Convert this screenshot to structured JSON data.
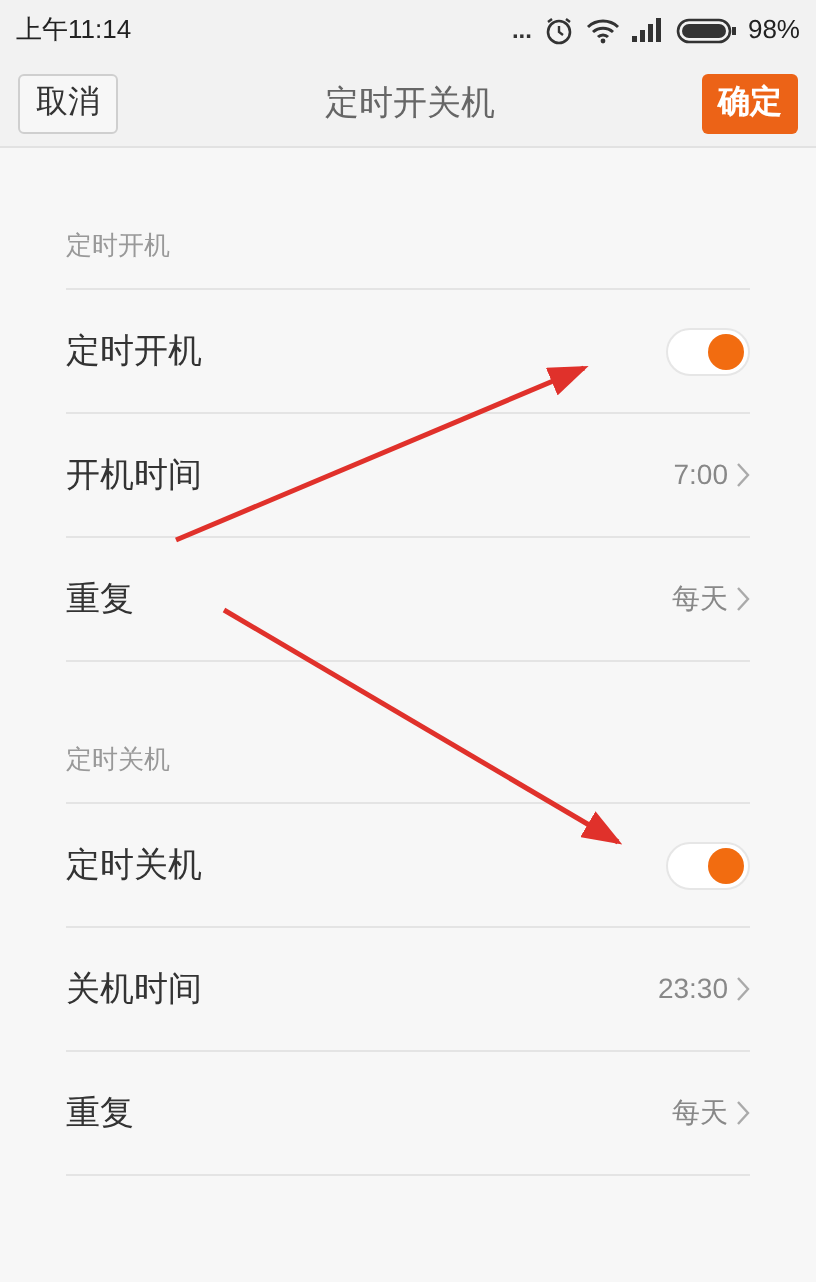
{
  "status_bar": {
    "time": "上午11:14",
    "dots": "...",
    "battery": "98%"
  },
  "nav": {
    "cancel": "取消",
    "title": "定时开关机",
    "confirm": "确定"
  },
  "sections": [
    {
      "header": "定时开机",
      "rows": [
        {
          "kind": "toggle",
          "label": "定时开机",
          "on": true
        },
        {
          "kind": "value",
          "label": "开机时间",
          "value": "7:00"
        },
        {
          "kind": "value",
          "label": "重复",
          "value": "每天"
        }
      ]
    },
    {
      "header": "定时关机",
      "rows": [
        {
          "kind": "toggle",
          "label": "定时关机",
          "on": true
        },
        {
          "kind": "value",
          "label": "关机时间",
          "value": "23:30"
        },
        {
          "kind": "value",
          "label": "重复",
          "value": "每天"
        }
      ]
    }
  ]
}
